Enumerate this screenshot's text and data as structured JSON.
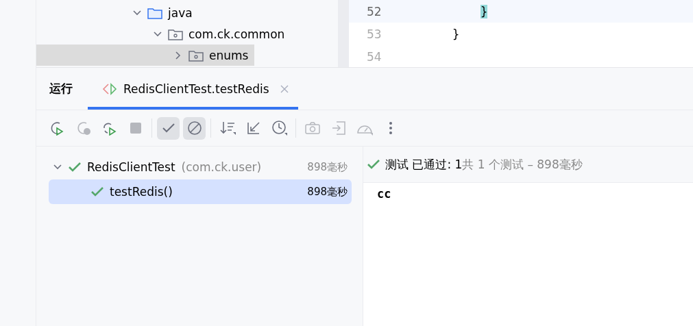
{
  "project_tree": [
    {
      "label": "java",
      "kind": "folder",
      "expanded": true,
      "children": [
        {
          "label": "com.ck.common",
          "kind": "package",
          "expanded": true,
          "children": [
            {
              "label": "enums",
              "kind": "package",
              "expanded": false,
              "selected": true
            }
          ]
        }
      ]
    }
  ],
  "editor": {
    "lines": [
      {
        "number": "52",
        "code": "        }",
        "current": true
      },
      {
        "number": "53",
        "code": "    }",
        "current": false
      },
      {
        "number": "54",
        "current": false
      }
    ]
  },
  "run_panel": {
    "title": "运行",
    "tabs": [
      {
        "label": "RedisClientTest.testRedis",
        "selected": true,
        "closable": true
      }
    ]
  },
  "toolbar": [
    {
      "kind": "rerun",
      "disabled": false,
      "toggled": false
    },
    {
      "kind": "rerunfailed",
      "disabled": true,
      "toggled": false
    },
    {
      "kind": "autorerun",
      "disabled": false,
      "toggled": false
    },
    {
      "kind": "stop",
      "disabled": true,
      "toggled": false
    },
    {
      "kind": "separator"
    },
    {
      "kind": "passed",
      "disabled": false,
      "toggled": true
    },
    {
      "kind": "ignored",
      "disabled": false,
      "toggled": true
    },
    {
      "kind": "separator"
    },
    {
      "kind": "sort",
      "disabled": false,
      "toggled": false
    },
    {
      "kind": "collapse",
      "disabled": false,
      "toggled": false
    },
    {
      "kind": "history",
      "disabled": false,
      "toggled": false
    },
    {
      "kind": "separator"
    },
    {
      "kind": "snapshot",
      "disabled": true,
      "toggled": false
    },
    {
      "kind": "import",
      "disabled": true,
      "toggled": false
    },
    {
      "kind": "speed",
      "disabled": true,
      "toggled": false
    },
    {
      "kind": "more",
      "disabled": false,
      "toggled": false
    }
  ],
  "test_tree": [
    {
      "name": "RedisClientTest",
      "package": "(com.ck.user)",
      "duration": "898毫秒",
      "passed": true,
      "expanded": true,
      "selected": false,
      "children": [
        {
          "name": "testRedis()",
          "duration": "898毫秒",
          "passed": true,
          "selected": true
        }
      ]
    }
  ],
  "summary": {
    "passed": true,
    "status": "测试 已通过: 1",
    "detail": "共 1 个测试 – 898毫秒"
  },
  "console": [
    "cc"
  ]
}
